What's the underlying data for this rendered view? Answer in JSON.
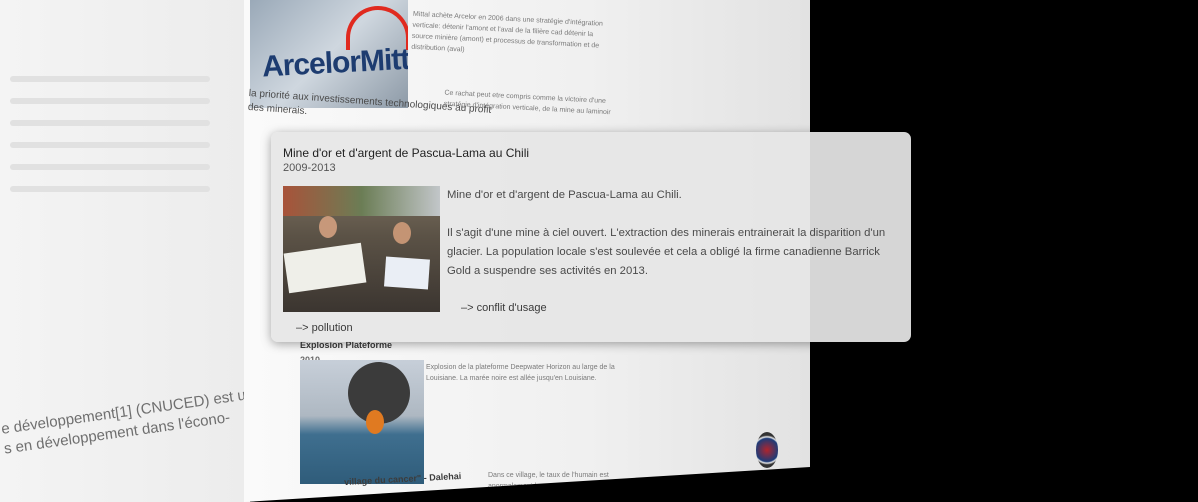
{
  "background": {
    "left_panel_text": [
      "e développement[1] (CNUCED) est un",
      "s en développement dans l'écono-"
    ],
    "arcelor": {
      "logo_text": "ArcelorMittal",
      "description": "Mittal achète Arcelor en 2006 dans une stratégie d'intégration verticale: détenir l'amont et l'aval de la filière cad détenir la source minière (amont) et processus de transformation et de distribution (aval)",
      "description2": "Ce rachat peut etre compris comme la victoire d'une stratégie d'intégration verticale, de la mine au laminoir",
      "priority_text": "la priorité aux investissements technologiques au profit des minerais."
    },
    "explosion": {
      "title": "Explosion Plateforme",
      "year": "2010",
      "description": "Explosion de la plateforme Deepwater Horizon au large de la Louisiane. La marée noire est allée jusqu'en Louisiane."
    },
    "village": {
      "title": "village du cancer\" - Dalehai",
      "description": "Dans ce village, le taux de l'humain est anormalement haut."
    }
  },
  "tooltip": {
    "title": "Mine d'or et d'argent de Pascua-Lama au Chili",
    "dates": "2009-2013",
    "photo_name": "protest-photo",
    "body_line1": "Mine d'or et d'argent de Pascua-Lama au Chili.",
    "body_line2": "Il s'agit d'une mine à ciel ouvert. L'extraction des minerais entrainerait la disparition d'un glacier. La population locale s'est soulevée et cela a obligé la firme canadienne Barrick Gold a suspendre ses activités en 2013.",
    "link_conflict": "–> conflit d'usage",
    "link_pollution": "–> pollution"
  }
}
